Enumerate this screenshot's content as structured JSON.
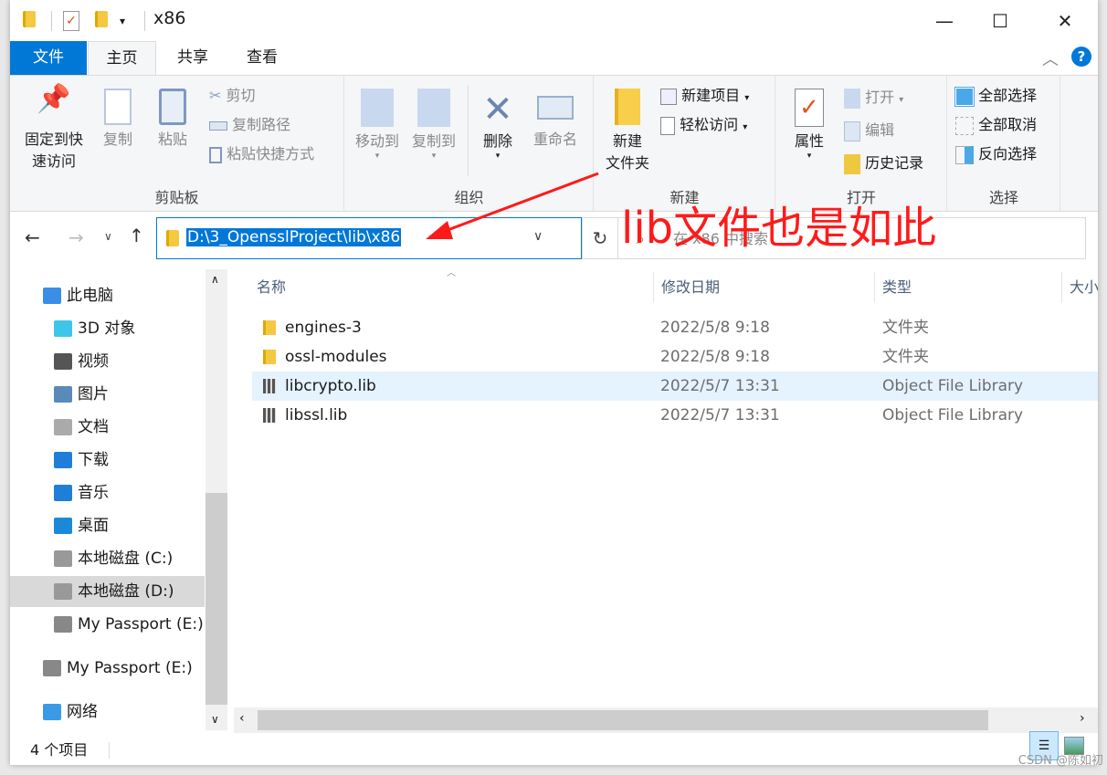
{
  "window": {
    "title": "x86",
    "minimize": "—",
    "maximize": "☐",
    "close": "✕"
  },
  "tabs": [
    {
      "label": "文件",
      "active": false,
      "accent": true
    },
    {
      "label": "主页",
      "active": true
    },
    {
      "label": "共享"
    },
    {
      "label": "查看"
    }
  ],
  "ribbon": {
    "clipboard": {
      "label": "剪贴板",
      "pin": "固定到快\n速访问",
      "pin1": "固定到快",
      "pin2": "速访问",
      "copy": "复制",
      "paste": "粘贴",
      "cut": "剪切",
      "copy_path": "复制路径",
      "paste_shortcut": "粘贴快捷方式"
    },
    "organize": {
      "label": "组织",
      "move_to": "移动到",
      "copy_to": "复制到",
      "delete": "删除",
      "rename": "重命名"
    },
    "new": {
      "label": "新建",
      "new_folder1": "新建",
      "new_folder2": "文件夹",
      "new_item": "新建项目",
      "easy_access": "轻松访问"
    },
    "open": {
      "label": "打开",
      "properties": "属性",
      "open": "打开",
      "edit": "编辑",
      "history": "历史记录"
    },
    "select": {
      "label": "选择",
      "select_all": "全部选择",
      "select_none": "全部取消",
      "invert": "反向选择"
    }
  },
  "address": {
    "path": "D:\\3_OpensslProject\\lib\\x86",
    "search_placeholder": "在 x86 中搜索"
  },
  "nav": [
    {
      "label": "此电脑",
      "icon": "computer-icon"
    },
    {
      "label": "3D 对象",
      "icon": "3d-objects-icon"
    },
    {
      "label": "视频",
      "icon": "video-icon"
    },
    {
      "label": "图片",
      "icon": "pictures-icon"
    },
    {
      "label": "文档",
      "icon": "documents-icon"
    },
    {
      "label": "下载",
      "icon": "download-icon"
    },
    {
      "label": "音乐",
      "icon": "music-icon"
    },
    {
      "label": "桌面",
      "icon": "desktop-icon"
    },
    {
      "label": "本地磁盘 (C:)",
      "icon": "drive-icon"
    },
    {
      "label": "本地磁盘 (D:)",
      "icon": "drive-icon",
      "selected": true
    },
    {
      "label": "My Passport (E:)",
      "icon": "usb-drive-icon"
    },
    {
      "label": "My Passport (E:)",
      "icon": "usb-drive-icon"
    },
    {
      "label": "网络",
      "icon": "network-icon"
    }
  ],
  "columns": {
    "name": "名称",
    "date": "修改日期",
    "type": "类型",
    "size": "大小"
  },
  "files": [
    {
      "name": "engines-3",
      "date": "2022/5/8 9:18",
      "type": "文件夹",
      "icon": "folder-icon"
    },
    {
      "name": "ossl-modules",
      "date": "2022/5/8 9:18",
      "type": "文件夹",
      "icon": "folder-icon"
    },
    {
      "name": "libcrypto.lib",
      "date": "2022/5/7 13:31",
      "type": "Object File Library",
      "icon": "library-file-icon",
      "highlighted": true
    },
    {
      "name": "libssl.lib",
      "date": "2022/5/7 13:31",
      "type": "Object File Library",
      "icon": "library-file-icon"
    }
  ],
  "status": {
    "count": "4 个项目"
  },
  "annotation": {
    "text": "lib文件也是如此",
    "color": "#ff1a1a"
  },
  "watermark": "CSDN @陈如初",
  "colors": {
    "accent": "#0078d7",
    "ribbon_bg": "#f5f6f7",
    "hover_row": "#e5f3ff"
  }
}
